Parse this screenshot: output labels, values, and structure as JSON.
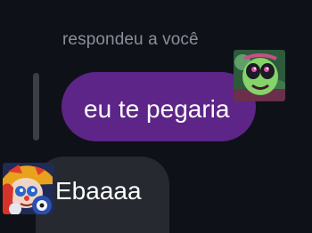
{
  "reply": {
    "caption": "respondeu a você"
  },
  "messages": {
    "outgoing_text": "eu te pegaria",
    "incoming_text": "Ebaaaa"
  },
  "colors": {
    "background": "#0e1118",
    "outgoing_bubble": "#5d2587",
    "incoming_bubble": "#262930",
    "caption_text": "#8c8f99",
    "quote_bar": "#3a3e47"
  },
  "icons": {
    "sender_avatar": "green-cartoon-character-avatar",
    "receiver_avatar": "clown-character-avatar"
  }
}
